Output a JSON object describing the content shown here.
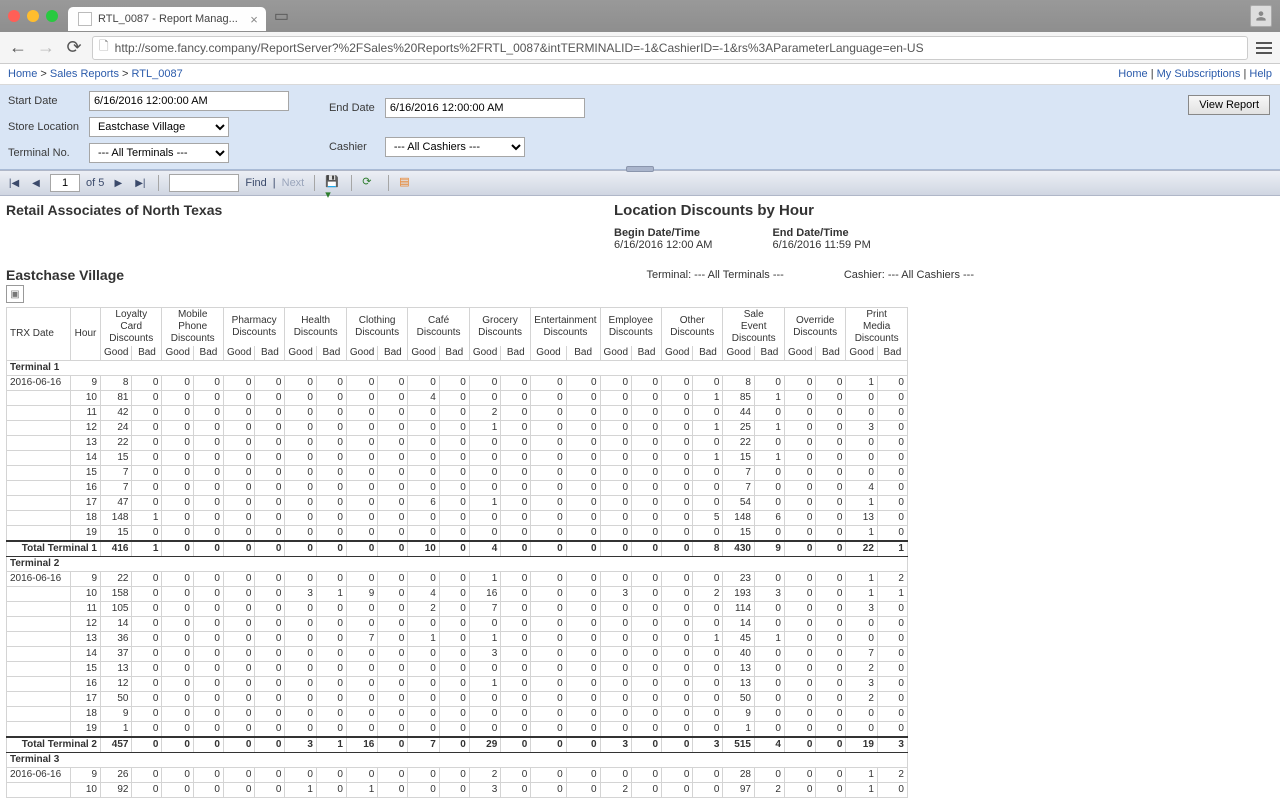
{
  "browser": {
    "tab_title": "RTL_0087 - Report Manag...",
    "url": "http://some.fancy.company/ReportServer?%2FSales%20Reports%2FRTL_0087&intTERMINALID=-1&CashierID=-1&rs%3AParameterLanguage=en-US"
  },
  "topbar": {
    "breadcrumb": [
      "Home",
      "Sales Reports",
      "RTL_0087"
    ],
    "links": [
      "Home",
      "My Subscriptions",
      "Help"
    ]
  },
  "params": {
    "start_label": "Start Date",
    "start_value": "6/16/2016 12:00:00 AM",
    "end_label": "End Date",
    "end_value": "6/16/2016 12:00:00 AM",
    "store_label": "Store Location",
    "store_value": "Eastchase Village",
    "cashier_label": "Cashier",
    "cashier_value": "--- All Cashiers ---",
    "terminal_label": "Terminal No.",
    "terminal_value": "--- All Terminals ---",
    "view_btn": "View Report"
  },
  "viewer": {
    "page_current": "1",
    "page_total": "of 5",
    "find_label": "Find",
    "next_label": "Next"
  },
  "report": {
    "company": "Retail Associates of North Texas",
    "title": "Location Discounts by Hour",
    "begin_label": "Begin Date/Time",
    "begin_value": "6/16/2016 12:00 AM",
    "end_label": "End Date/Time",
    "end_value": "6/16/2016 11:59 PM",
    "location": "Eastchase Village",
    "terminal_line": "Terminal: --- All Terminals ---",
    "cashier_line": "Cashier: --- All Cashiers ---"
  },
  "table": {
    "col_trx": "TRX Date",
    "col_hour": "Hour",
    "groups": [
      "Loyalty Card Discounts",
      "Mobile Phone Discounts",
      "Pharmacy Discounts",
      "Health Discounts",
      "Clothing Discounts",
      "Café Discounts",
      "Grocery Discounts",
      "Entertainment Discounts",
      "Employee Discounts",
      "Other Discounts",
      "Sale Event Discounts",
      "Override Discounts",
      "Print Media Discounts"
    ],
    "sub": [
      "Good",
      "Bad"
    ],
    "terminals": [
      {
        "name": "Terminal 1",
        "date": "2016-06-16",
        "total_label": "Total Terminal 1",
        "rows": [
          [
            9,
            8,
            0,
            0,
            0,
            0,
            0,
            0,
            0,
            0,
            0,
            0,
            0,
            0,
            0,
            0,
            0,
            0,
            0,
            0,
            0,
            8,
            0,
            0,
            0,
            1,
            0
          ],
          [
            10,
            81,
            0,
            0,
            0,
            0,
            0,
            0,
            0,
            0,
            0,
            4,
            0,
            0,
            0,
            0,
            0,
            0,
            0,
            0,
            1,
            85,
            1,
            0,
            0,
            0,
            0
          ],
          [
            11,
            42,
            0,
            0,
            0,
            0,
            0,
            0,
            0,
            0,
            0,
            0,
            0,
            2,
            0,
            0,
            0,
            0,
            0,
            0,
            0,
            44,
            0,
            0,
            0,
            0,
            0
          ],
          [
            12,
            24,
            0,
            0,
            0,
            0,
            0,
            0,
            0,
            0,
            0,
            0,
            0,
            1,
            0,
            0,
            0,
            0,
            0,
            0,
            1,
            25,
            1,
            0,
            0,
            3,
            0
          ],
          [
            13,
            22,
            0,
            0,
            0,
            0,
            0,
            0,
            0,
            0,
            0,
            0,
            0,
            0,
            0,
            0,
            0,
            0,
            0,
            0,
            0,
            22,
            0,
            0,
            0,
            0,
            0
          ],
          [
            14,
            15,
            0,
            0,
            0,
            0,
            0,
            0,
            0,
            0,
            0,
            0,
            0,
            0,
            0,
            0,
            0,
            0,
            0,
            0,
            1,
            15,
            1,
            0,
            0,
            0,
            0
          ],
          [
            15,
            7,
            0,
            0,
            0,
            0,
            0,
            0,
            0,
            0,
            0,
            0,
            0,
            0,
            0,
            0,
            0,
            0,
            0,
            0,
            0,
            7,
            0,
            0,
            0,
            0,
            0
          ],
          [
            16,
            7,
            0,
            0,
            0,
            0,
            0,
            0,
            0,
            0,
            0,
            0,
            0,
            0,
            0,
            0,
            0,
            0,
            0,
            0,
            0,
            7,
            0,
            0,
            0,
            4,
            0
          ],
          [
            17,
            47,
            0,
            0,
            0,
            0,
            0,
            0,
            0,
            0,
            0,
            6,
            0,
            1,
            0,
            0,
            0,
            0,
            0,
            0,
            0,
            54,
            0,
            0,
            0,
            1,
            0
          ],
          [
            18,
            148,
            1,
            0,
            0,
            0,
            0,
            0,
            0,
            0,
            0,
            0,
            0,
            0,
            0,
            0,
            0,
            0,
            0,
            0,
            5,
            148,
            6,
            0,
            0,
            13,
            0
          ],
          [
            19,
            15,
            0,
            0,
            0,
            0,
            0,
            0,
            0,
            0,
            0,
            0,
            0,
            0,
            0,
            0,
            0,
            0,
            0,
            0,
            0,
            15,
            0,
            0,
            0,
            1,
            0
          ]
        ],
        "total": [
          416,
          1,
          0,
          0,
          0,
          0,
          0,
          0,
          0,
          0,
          10,
          0,
          4,
          0,
          0,
          0,
          0,
          0,
          0,
          8,
          430,
          9,
          0,
          0,
          22,
          1,
          0
        ]
      },
      {
        "name": "Terminal 2",
        "date": "2016-06-16",
        "total_label": "Total Terminal 2",
        "rows": [
          [
            9,
            22,
            0,
            0,
            0,
            0,
            0,
            0,
            0,
            0,
            0,
            0,
            0,
            1,
            0,
            0,
            0,
            0,
            0,
            0,
            0,
            23,
            0,
            0,
            0,
            1,
            2,
            0
          ],
          [
            10,
            158,
            0,
            0,
            0,
            0,
            0,
            3,
            1,
            9,
            0,
            4,
            0,
            16,
            0,
            0,
            0,
            3,
            0,
            0,
            2,
            193,
            3,
            0,
            0,
            1,
            1,
            0
          ],
          [
            11,
            105,
            0,
            0,
            0,
            0,
            0,
            0,
            0,
            0,
            0,
            2,
            0,
            7,
            0,
            0,
            0,
            0,
            0,
            0,
            0,
            114,
            0,
            0,
            0,
            3,
            0,
            0
          ],
          [
            12,
            14,
            0,
            0,
            0,
            0,
            0,
            0,
            0,
            0,
            0,
            0,
            0,
            0,
            0,
            0,
            0,
            0,
            0,
            0,
            0,
            14,
            0,
            0,
            0,
            0,
            0,
            0
          ],
          [
            13,
            36,
            0,
            0,
            0,
            0,
            0,
            0,
            0,
            7,
            0,
            1,
            0,
            1,
            0,
            0,
            0,
            0,
            0,
            0,
            1,
            45,
            1,
            0,
            0,
            0,
            0,
            0
          ],
          [
            14,
            37,
            0,
            0,
            0,
            0,
            0,
            0,
            0,
            0,
            0,
            0,
            0,
            3,
            0,
            0,
            0,
            0,
            0,
            0,
            0,
            40,
            0,
            0,
            0,
            7,
            0,
            0
          ],
          [
            15,
            13,
            0,
            0,
            0,
            0,
            0,
            0,
            0,
            0,
            0,
            0,
            0,
            0,
            0,
            0,
            0,
            0,
            0,
            0,
            0,
            13,
            0,
            0,
            0,
            2,
            0,
            0
          ],
          [
            16,
            12,
            0,
            0,
            0,
            0,
            0,
            0,
            0,
            0,
            0,
            0,
            0,
            1,
            0,
            0,
            0,
            0,
            0,
            0,
            0,
            13,
            0,
            0,
            0,
            3,
            0,
            0
          ],
          [
            17,
            50,
            0,
            0,
            0,
            0,
            0,
            0,
            0,
            0,
            0,
            0,
            0,
            0,
            0,
            0,
            0,
            0,
            0,
            0,
            0,
            50,
            0,
            0,
            0,
            2,
            0,
            0
          ],
          [
            18,
            9,
            0,
            0,
            0,
            0,
            0,
            0,
            0,
            0,
            0,
            0,
            0,
            0,
            0,
            0,
            0,
            0,
            0,
            0,
            0,
            9,
            0,
            0,
            0,
            0,
            0,
            0
          ],
          [
            19,
            1,
            0,
            0,
            0,
            0,
            0,
            0,
            0,
            0,
            0,
            0,
            0,
            0,
            0,
            0,
            0,
            0,
            0,
            0,
            0,
            1,
            0,
            0,
            0,
            0,
            0,
            0
          ]
        ],
        "total": [
          457,
          0,
          0,
          0,
          0,
          0,
          3,
          1,
          16,
          0,
          7,
          0,
          29,
          0,
          0,
          0,
          3,
          0,
          0,
          3,
          515,
          4,
          0,
          0,
          19,
          3,
          0
        ]
      },
      {
        "name": "Terminal 3",
        "date": "2016-06-16",
        "total_label": "",
        "rows": [
          [
            9,
            26,
            0,
            0,
            0,
            0,
            0,
            0,
            0,
            0,
            0,
            0,
            0,
            2,
            0,
            0,
            0,
            0,
            0,
            0,
            0,
            28,
            0,
            0,
            0,
            1,
            2,
            0
          ],
          [
            10,
            92,
            0,
            0,
            0,
            0,
            0,
            1,
            0,
            1,
            0,
            0,
            0,
            3,
            0,
            0,
            0,
            2,
            0,
            0,
            0,
            97,
            2,
            0,
            0,
            1,
            0,
            0
          ]
        ]
      }
    ]
  }
}
